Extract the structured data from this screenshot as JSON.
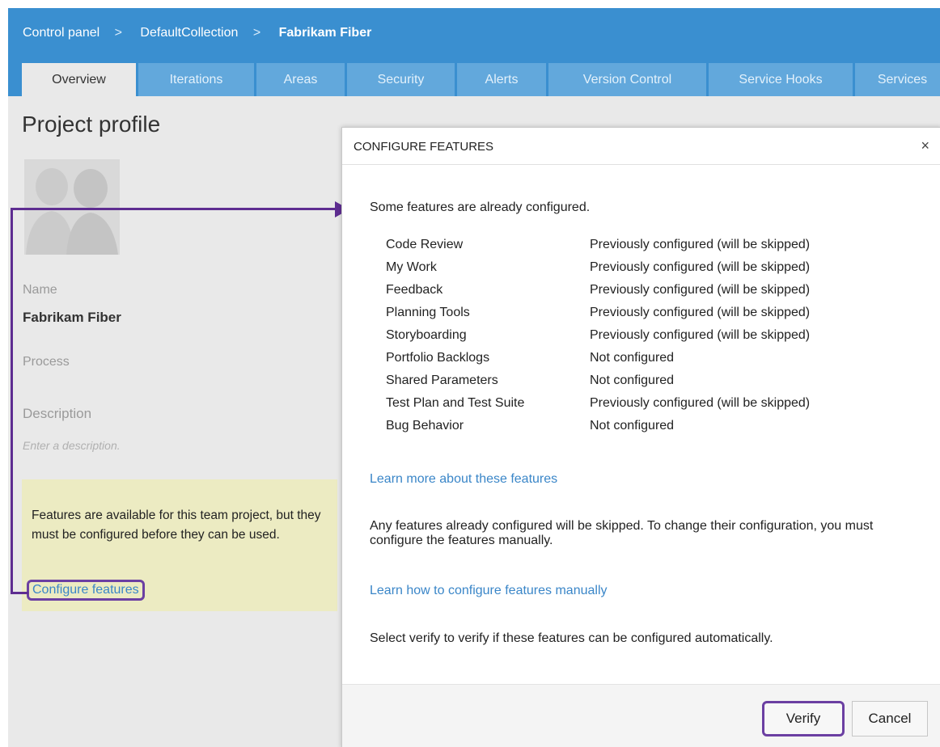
{
  "breadcrumb": {
    "items": [
      "Control panel",
      "DefaultCollection",
      "Fabrikam Fiber"
    ],
    "separator": ">"
  },
  "tabs": [
    "Overview",
    "Iterations",
    "Areas",
    "Security",
    "Alerts",
    "Version Control",
    "Service Hooks",
    "Services"
  ],
  "profile": {
    "title": "Project profile",
    "name_label": "Name",
    "name_value": "Fabrikam Fiber",
    "process_label": "Process",
    "description_label": "Description",
    "description_placeholder": "Enter a description."
  },
  "notice": {
    "text": "Features are available for this team project, but they must be configured before they can be used.",
    "link": "Configure features"
  },
  "dialog": {
    "title": "CONFIGURE FEATURES",
    "close": "×",
    "intro": "Some features are already configured.",
    "features": [
      {
        "name": "Code Review",
        "status": "Previously configured (will be skipped)"
      },
      {
        "name": "My Work",
        "status": "Previously configured (will be skipped)"
      },
      {
        "name": "Feedback",
        "status": "Previously configured (will be skipped)"
      },
      {
        "name": "Planning Tools",
        "status": "Previously configured (will be skipped)"
      },
      {
        "name": "Storyboarding",
        "status": "Previously configured (will be skipped)"
      },
      {
        "name": "Portfolio Backlogs",
        "status": "Not configured"
      },
      {
        "name": "Shared Parameters",
        "status": "Not configured"
      },
      {
        "name": "Test Plan and Test Suite",
        "status": "Previously configured (will be skipped)"
      },
      {
        "name": "Bug Behavior",
        "status": "Not configured"
      }
    ],
    "learn_more_link": "Learn more about these features",
    "skip_note": "Any features already configured will be skipped. To change their configuration, you must configure the features manually.",
    "manual_link": "Learn how to configure features manually",
    "verify_note": "Select verify to verify if these features can be configured automatically.",
    "verify_button": "Verify",
    "cancel_button": "Cancel"
  },
  "colors": {
    "header": "#3a8fd0",
    "tab_inactive": "#62a8dc",
    "link": "#3a86c8",
    "highlight": "#6b3fa2",
    "notice_bg": "#ecebc2"
  }
}
